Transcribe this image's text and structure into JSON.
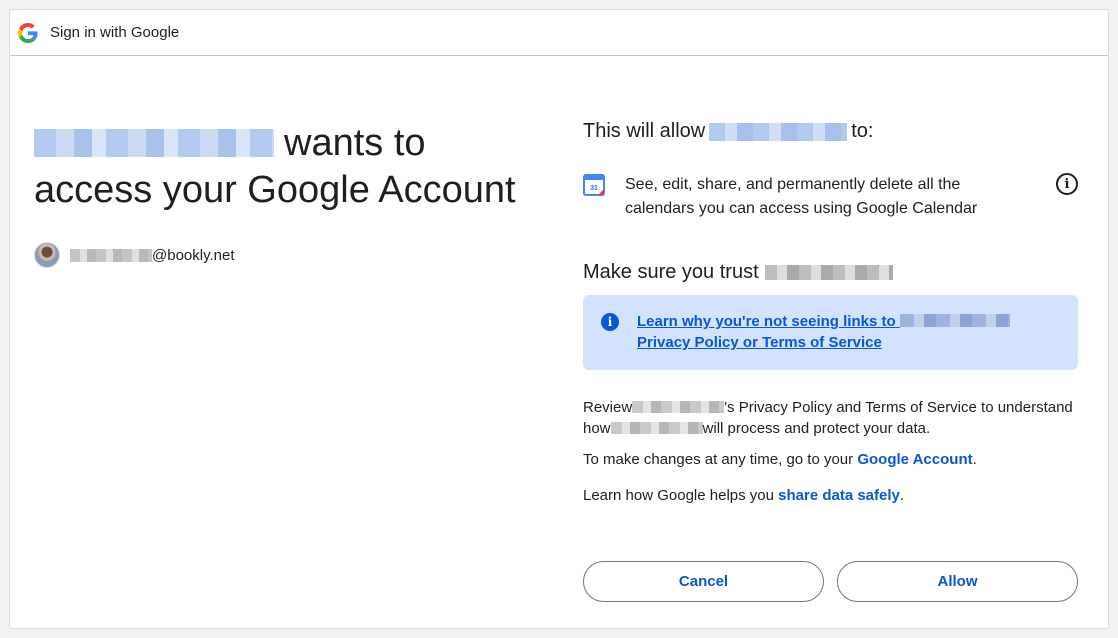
{
  "titlebar": {
    "title": "Sign in with Google",
    "logo_icon": "google-g-icon"
  },
  "headline": {
    "suffix_line1": "wants to",
    "line2": "access your Google Account"
  },
  "account": {
    "email_domain": "@bookly.net"
  },
  "scopes": {
    "intro_prefix": "This will allow",
    "intro_suffix": "to:",
    "items": [
      {
        "icon": "google-calendar-icon",
        "text": "See, edit, share, and permanently delete all the calendars you can access using Google Calendar"
      }
    ]
  },
  "trust": {
    "title": "Make sure you trust",
    "notice_prefix": "Learn why you're not seeing links to",
    "notice_suffix": "Privacy Policy or Terms of Service"
  },
  "review": {
    "part1": "Review",
    "part2": "'s Privacy Policy and Terms of Service to understand how",
    "part3": "will process and protect your data."
  },
  "changes": {
    "prefix": "To make changes at any time, go to your ",
    "link": "Google Account",
    "suffix": "."
  },
  "learn": {
    "prefix": "Learn how Google helps you ",
    "link": "share data safely",
    "suffix": "."
  },
  "buttons": {
    "cancel": "Cancel",
    "allow": "Allow"
  },
  "colors": {
    "accent": "#0b57d0",
    "notice_bg": "#d3e3fd"
  }
}
